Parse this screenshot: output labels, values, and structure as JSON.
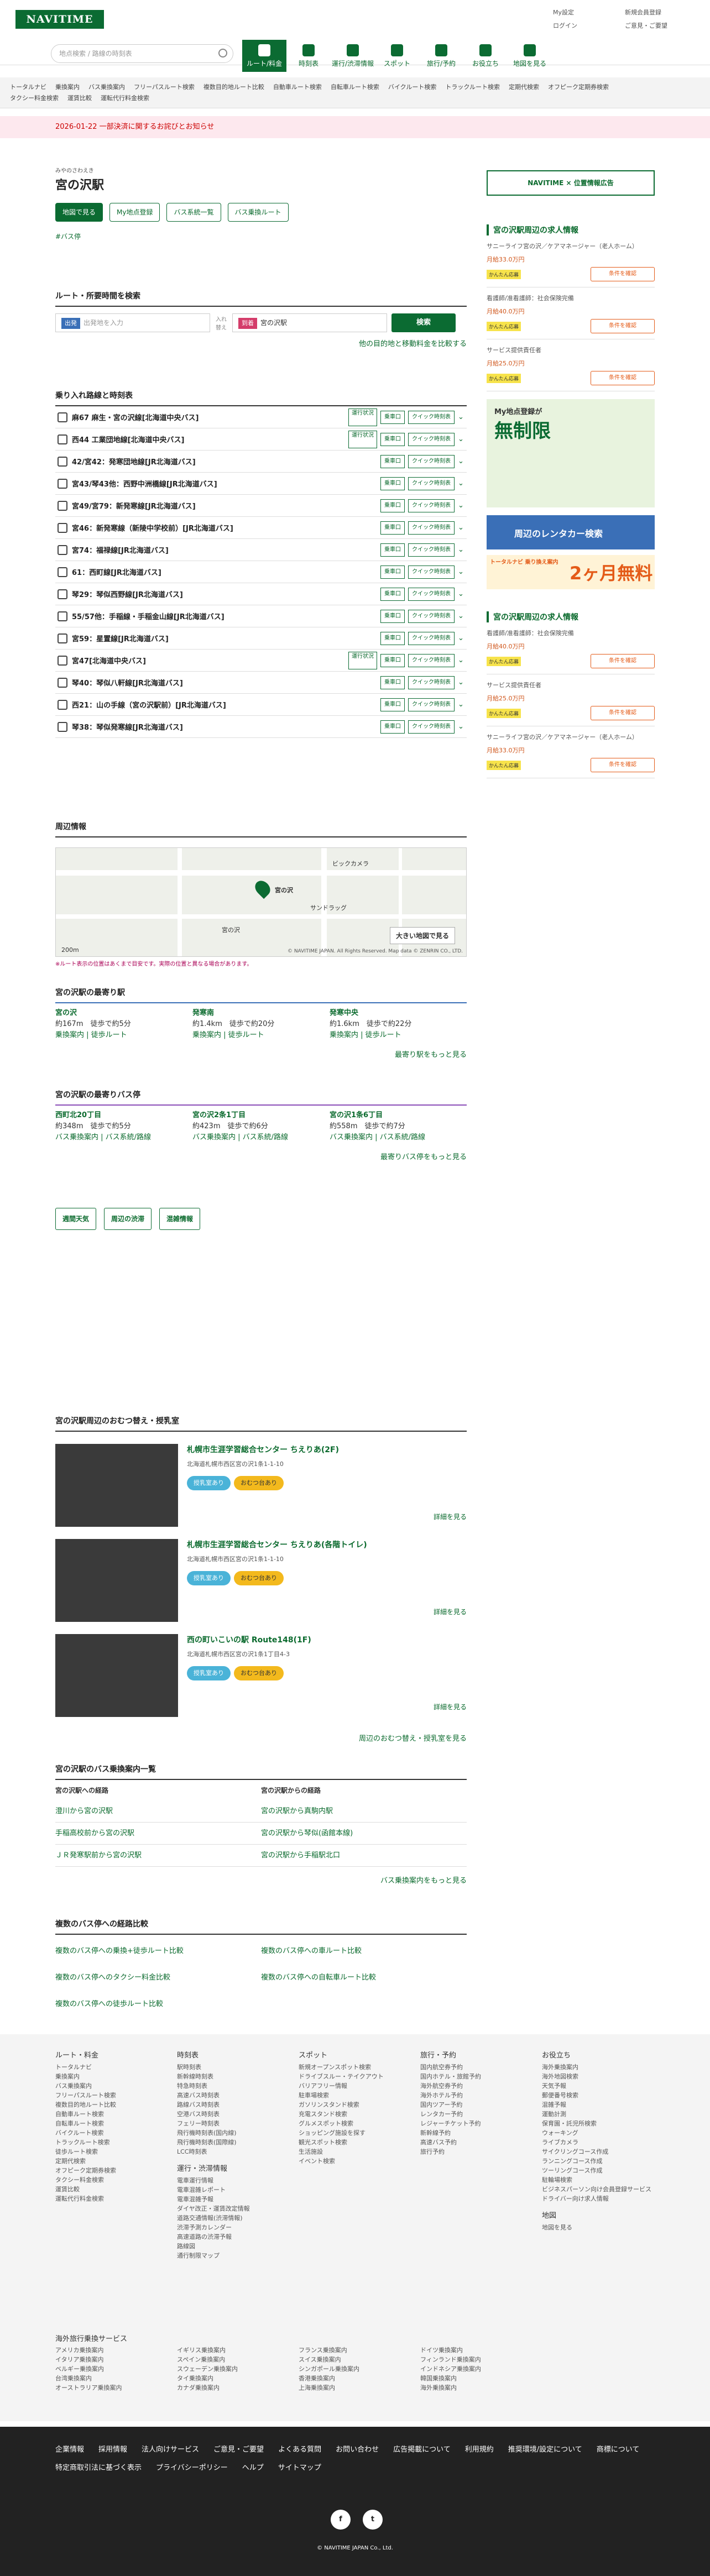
{
  "header": {
    "logo": "NAVITIME",
    "search_placeholder": "地点検索 / 路線の時刻表",
    "nav": [
      {
        "label": "ルート/料金"
      },
      {
        "label": "時刻表"
      },
      {
        "label": "運行/渋滞情報"
      },
      {
        "label": "スポット"
      },
      {
        "label": "旅行/予約"
      },
      {
        "label": "お役立ち"
      },
      {
        "label": "地図を見る"
      }
    ],
    "util": [
      "My設定",
      "新規会員登録",
      "ログイン",
      "ご意見・ご要望"
    ]
  },
  "subnav": [
    "トータルナビ",
    "乗換案内",
    "バス乗換案内",
    "フリーパスルート検索",
    "複数目的地ルート比較",
    "自動車ルート検索",
    "自転車ルート検索",
    "バイクルート検索",
    "トラックルート検索",
    "定期代検索",
    "オフピーク定期券検索",
    "タクシー料金検索",
    "運賃比較",
    "運転代行料金検索"
  ],
  "notice": "2026-01-22 一部決済に関するお詫びとお知らせ",
  "station": {
    "ruby": "みやのさわえき",
    "name": "宮の沢駅",
    "btn_map": "地図で見る",
    "btn_my": "My地点登録",
    "btn_lines": "バス系統一覧",
    "btn_route": "バス乗換ルート",
    "tag": "#バス停"
  },
  "route": {
    "title": "ルート・所要時間を検索",
    "from_label": "出発",
    "from_ph": "出発地を入力",
    "swap": "入れ替え",
    "to_label": "到着",
    "to_val": "宮の沢駅",
    "search": "検索",
    "compare": "他の目的地と移動料金を比較する"
  },
  "lines": {
    "title": "乗り入れ路線と時刻表",
    "items": [
      {
        "name": "麻67 麻生・宮の沢線[北海道中央バス]",
        "op": "運行状況"
      },
      {
        "name": "西44 工業団地線[北海道中央バス]",
        "op": "運行状況"
      },
      {
        "name": "42/宮42：発寒団地線[JR北海道バス]",
        "op": ""
      },
      {
        "name": "宮43/琴43他：西野中洲橋線[JR北海道バス]",
        "op": ""
      },
      {
        "name": "宮49/宮79：新発寒線[JR北海道バス]",
        "op": ""
      },
      {
        "name": "宮46：新発寒線（新陵中学校前）[JR北海道バス]",
        "op": ""
      },
      {
        "name": "宮74：福禄線[JR北海道バス]",
        "op": ""
      },
      {
        "name": "61：西町線[JR北海道バス]",
        "op": ""
      },
      {
        "name": "琴29：琴似西野線[JR北海道バス]",
        "op": ""
      },
      {
        "name": "55/57他：手稲線・手稲金山線[JR北海道バス]",
        "op": ""
      },
      {
        "name": "宮59：星置線[JR北海道バス]",
        "op": ""
      },
      {
        "name": "宮47[北海道中央バス]",
        "op": "運行状況"
      },
      {
        "name": "琴40：琴似八軒線[JR北海道バス]",
        "op": ""
      },
      {
        "name": "西21：山の手線（宮の沢駅前）[JR北海道バス]",
        "op": ""
      },
      {
        "name": "琴38：琴似発寒線[JR北海道バス]",
        "op": ""
      }
    ],
    "approach": "乗車口",
    "quick": "クイック時刻表"
  },
  "map": {
    "title": "周辺情報",
    "station": "宮の沢",
    "big": "大きい地図で見る",
    "credit": "© NAVITIME JAPAN. All Rights Reserved. Map data © ZENRIN CO., LTD.",
    "scale": "200m",
    "note": "※ルート表示の位置はあくまで目安です。実際の位置と異なる場合があります。",
    "places": [
      "ビックカメラ",
      "サンドラッグ",
      "宮の沢"
    ]
  },
  "nearest_st": {
    "title": "宮の沢駅の最寄り駅",
    "items": [
      {
        "name": "宮の沢",
        "dist": "約167m",
        "walk": "徒歩で約5分",
        "l1": "乗換案内",
        "l2": "徒歩ルート"
      },
      {
        "name": "発寒南",
        "dist": "約1.4km",
        "walk": "徒歩で約20分",
        "l1": "乗換案内",
        "l2": "徒歩ルート"
      },
      {
        "name": "発寒中央",
        "dist": "約1.6km",
        "walk": "徒歩で約22分",
        "l1": "乗換案内",
        "l2": "徒歩ルート"
      }
    ],
    "more": "最寄り駅をもっと見る"
  },
  "nearest_bus": {
    "title": "宮の沢駅の最寄りバス停",
    "items": [
      {
        "name": "西町北20丁目",
        "dist": "約348m",
        "walk": "徒歩で約5分",
        "l1": "バス乗換案内",
        "l2": "バス系統/路線"
      },
      {
        "name": "宮の沢2条1丁目",
        "dist": "約423m",
        "walk": "徒歩で約6分",
        "l1": "バス乗換案内",
        "l2": "バス系統/路線"
      },
      {
        "name": "宮の沢1条6丁目",
        "dist": "約558m",
        "walk": "徒歩で約7分",
        "l1": "バス乗換案内",
        "l2": "バス系統/路線"
      }
    ],
    "more": "最寄りバス停をもっと見る"
  },
  "tools": [
    "週間天気",
    "周辺の渋滞",
    "混雑情報"
  ],
  "nursing": {
    "title": "宮の沢駅周辺のおむつ替え・授乳室",
    "items": [
      {
        "name": "札幌市生涯学習総合センター ちえりあ(2F)",
        "addr": "北海道札幌市西区宮の沢1条1-1-10",
        "c1": "授乳室あり",
        "c2": "おむつ台あり",
        "detail": "詳細を見る"
      },
      {
        "name": "札幌市生涯学習総合センター ちえりあ(各階トイレ)",
        "addr": "北海道札幌市西区宮の沢1条1-1-10",
        "c1": "授乳室あり",
        "c2": "おむつ台あり",
        "detail": "詳細を見る"
      },
      {
        "name": "西の町いこいの駅 Route148(1F)",
        "addr": "北海道札幌市西区宮の沢1条1丁目4-3",
        "c1": "授乳室あり",
        "c2": "おむつ台あり",
        "detail": "詳細を見る"
      }
    ],
    "more": "周辺のおむつ替え・授乳室を見る"
  },
  "busroutes": {
    "title": "宮の沢駅のバス乗換案内一覧",
    "to_h": "宮の沢駅への経路",
    "from_h": "宮の沢駅からの経路",
    "to": [
      "澄川から宮の沢駅",
      "手稲高校前から宮の沢駅",
      "ＪＲ発寒駅前から宮の沢駅"
    ],
    "from": [
      "宮の沢駅から真駒内駅",
      "宮の沢駅から琴似(函館本線)",
      "宮の沢駅から手稲駅北口"
    ],
    "more": "バス乗換案内をもっと見る"
  },
  "multi": {
    "title": "複数のバス停への経路比較",
    "items": [
      "複数のバス停への乗換+徒歩ルート比較",
      "複数のバス停への車ルート比較",
      "複数のバス停へのタクシー料金比較",
      "複数のバス停への自転車ルート比較",
      "複数のバス停への徒歩ルート比較"
    ]
  },
  "side": {
    "ad": "NAVITIME × 位置情報広告",
    "jobs1_title": "宮の沢駅周辺の求人情報",
    "jobs1": [
      {
        "t": "サニーライフ宮の沢／ケアマネージャー（老人ホーム）",
        "pay": "月給33.0万円",
        "ent": "かんたん応募"
      },
      {
        "t": "看護師/准看護師：社会保険完備",
        "pay": "月給40.0万円",
        "ent": "かんたん応募"
      },
      {
        "t": "サービス提供責任者",
        "pay": "月給25.0万円",
        "ent": "かんたん応募"
      }
    ],
    "cond": "条件を確認",
    "banner_s": "My地点登録が",
    "banner_t": "無制限",
    "rent": "周辺のレンタカー検索",
    "prem_s": "トータルナビ 乗り換え案内",
    "prem_t": "2ヶ月無料",
    "jobs2_title": "宮の沢駅周辺の求人情報",
    "jobs2": [
      {
        "t": "看護師/准看護師：社会保険完備",
        "pay": "月給40.0万円",
        "ent": "かんたん応募"
      },
      {
        "t": "サービス提供責任者",
        "pay": "月給25.0万円",
        "ent": "かんたん応募"
      },
      {
        "t": "サニーライフ宮の沢／ケアマネージャー（老人ホーム）",
        "pay": "月給33.0万円",
        "ent": "かんたん応募"
      }
    ]
  },
  "footer": {
    "cols": [
      {
        "h": "ルート・料金",
        "items": [
          "トータルナビ",
          "乗換案内",
          "バス乗換案内",
          "フリーパスルート検索",
          "複数目的地ルート比較",
          "自動車ルート検索",
          "自転車ルート検索",
          "バイクルート検索",
          "トラックルート検索",
          "徒歩ルート検索",
          "定期代検索",
          "オフピーク定期券検索",
          "タクシー料金検索",
          "運賃比較",
          "運転代行料金検索"
        ]
      },
      {
        "h": "時刻表",
        "items": [
          "駅時刻表",
          "新幹線時刻表",
          "特急時刻表",
          "高速バス時刻表",
          "路線バス時刻表",
          "空港バス時刻表",
          "フェリー時刻表",
          "飛行機時刻表(国内線)",
          "飛行機時刻表(国際線)",
          "LCC時刻表"
        ]
      },
      {
        "h": "スポット",
        "items": [
          "新規オープンスポット検索",
          "ドライブスルー・テイクアウト",
          "バリアフリー情報",
          "駐車場検索",
          "ガソリンスタンド検索",
          "充電スタンド検索",
          "グルメスポット検索",
          "ショッピング施設を探す",
          "観光スポット検索",
          "生活施設",
          "イベント検索"
        ]
      },
      {
        "h": "旅行・予約",
        "items": [
          "国内航空券予約",
          "国内ホテル・旅館予約",
          "海外航空券予約",
          "海外ホテル予約",
          "国内ツアー予約",
          "レンタカー予約",
          "レジャーチケット予約",
          "新幹線予約",
          "高速バス予約",
          "旅行予約"
        ]
      },
      {
        "h": "お役立ち",
        "items": [
          "海外乗換案内",
          "海外地図検索",
          "天気予報",
          "郵便番号検索",
          "混雑予報",
          "運動計測",
          "保育園・託児所検索",
          "ウォーキング",
          "ライブカメラ",
          "サイクリングコース作成",
          "ランニングコース作成",
          "ツーリングコース作成",
          "駐輪場検索",
          "ビジネスパーソン向け会員登録サービス",
          "ドライバー向け求人情報"
        ]
      }
    ],
    "col2b": {
      "h": "運行・渋滞情報",
      "items": [
        "電車運行情報",
        "電車混雑レポート",
        "電車混雑予報",
        "ダイヤ改正・運賃改定情報",
        "道路交通情報(渋滞情報)",
        "渋滞予測カレンダー",
        "高速道路の渋滞予報",
        "路線図",
        "通行制限マップ"
      ]
    },
    "col5b": {
      "h": "地図",
      "items": [
        "地図を見る"
      ]
    },
    "overseas_h": "海外旅行乗換サービス",
    "overseas": [
      "アメリカ乗換案内",
      "イギリス乗換案内",
      "フランス乗換案内",
      "ドイツ乗換案内",
      "イタリア乗換案内",
      "スペイン乗換案内",
      "スイス乗換案内",
      "フィンランド乗換案内",
      "ベルギー乗換案内",
      "スウェーデン乗換案内",
      "シンガポール乗換案内",
      "インドネシア乗換案内",
      "台湾乗換案内",
      "タイ乗換案内",
      "香港乗換案内",
      "韓国乗換案内",
      "オーストラリア乗換案内",
      "カナダ乗換案内",
      "上海乗換案内",
      "海外乗換案内"
    ],
    "links": [
      "企業情報",
      "採用情報",
      "法人向けサービス",
      "ご意見・ご要望",
      "よくある質問",
      "お問い合わせ",
      "広告掲載について",
      "利用規約",
      "推奨環境/設定について",
      "商標について",
      "特定商取引法に基づく表示",
      "プライバシーポリシー",
      "ヘルプ",
      "サイトマップ"
    ],
    "social": [
      "f",
      "t"
    ],
    "copy": "© NAVITIME JAPAN Co., Ltd."
  }
}
